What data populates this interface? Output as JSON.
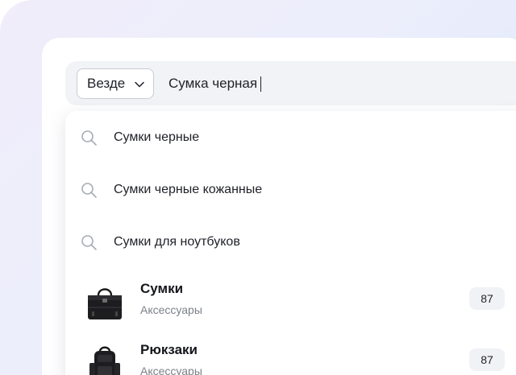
{
  "search": {
    "scope_label": "Везде",
    "query": "Сумка черная"
  },
  "suggestions": [
    {
      "text": "Сумки черные",
      "icon": "search-icon"
    },
    {
      "text": "Сумки черные кожанные",
      "icon": "search-icon"
    },
    {
      "text": "Сумки для ноутбуков",
      "icon": "search-icon"
    }
  ],
  "categories": [
    {
      "title": "Сумки",
      "subtitle": "Аксессуары",
      "count": "87",
      "icon": "bag-thumbnail"
    },
    {
      "title": "Рюкзаки",
      "subtitle": "Аксессуары",
      "count": "87",
      "icon": "backpack-thumbnail"
    }
  ],
  "colors": {
    "backdrop": "#eceefb",
    "search_bar": "#f2f3f7",
    "text": "#1f2128",
    "muted": "#7c808a",
    "badge": "#f1f2f5"
  }
}
